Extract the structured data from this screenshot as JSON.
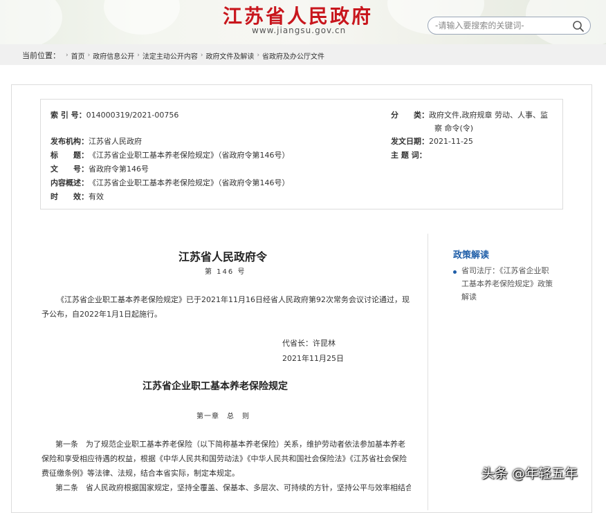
{
  "header": {
    "site_title": "江苏省人民政府",
    "site_url": "www.jiangsu.gov.cn",
    "search_placeholder": "-请输入要搜索的关键词-"
  },
  "breadcrumb": {
    "label": "当前位置：",
    "items": [
      "首页",
      "政府信息公开",
      "法定主动公开内容",
      "政府文件及解读",
      "省政府及办公厅文件"
    ]
  },
  "meta": {
    "index_label": "索 引 号：",
    "index_value": "014000319/2021-00756",
    "category_label": "分　　类：",
    "category_value_1": "政府文件,政府规章 劳动、人事、监",
    "category_value_2": "察 命令(令)",
    "publisher_label": "发布机构：",
    "publisher_value": "江苏省人民政府",
    "date_label": "发文日期：",
    "date_value": "2021-11-25",
    "title_label": "标　　题：",
    "title_value": "《江苏省企业职工基本养老保险规定》（省政府令第146号）",
    "subject_label": "主 题 词：",
    "subject_value": "",
    "docno_label": "文　　号：",
    "docno_value": "省政府令第146号",
    "summary_label": "内容概述：",
    "summary_value": "《江苏省企业职工基本养老保险规定》（省政府令第146号）",
    "validity_label": "时　　效：",
    "validity_value": "有效"
  },
  "article": {
    "title": "江苏省人民政府令",
    "number": "第 146 号",
    "para1": "《江苏省企业职工基本养老保险规定》已于2021年11月16日经省人民政府第92次常务会议讨论通过，现予公布，自2022年1月1日起施行。",
    "signer": "代省长：许昆林",
    "sign_date": "2021年11月25日",
    "rule_title": "江苏省企业职工基本养老保险规定",
    "chapter": "第一章　总　则",
    "art1": "第一条　为了规范企业职工基本养老保险（以下简称基本养老保险）关系，维护劳动者依法参加基本养老保险和享受相应待遇的权益，根据《中华人民共和国劳动法》《中华人民共和国社会保险法》《江苏省社会保险费征缴条例》等法律、法规，结合本省实际，制定本规定。",
    "art2": "第二条　省人民政府根据国家规定，坚持全覆盖、保基本、多层次、可持续的方针，坚持公平与效率相结合"
  },
  "side": {
    "title": "政策解读",
    "link": "省司法厅：《江苏省企业职工基本养老保险规定》政策解读"
  },
  "watermark": "头条 @年轻五年"
}
